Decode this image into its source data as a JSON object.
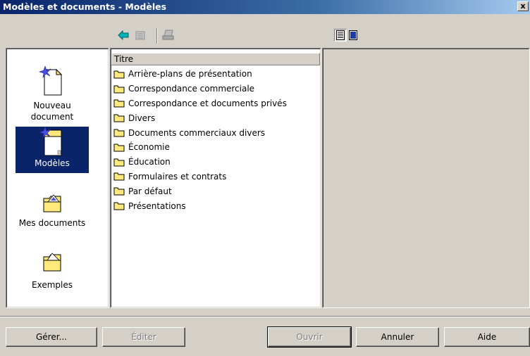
{
  "window": {
    "title": "Modèles et documents - Modèles",
    "close_label": "x"
  },
  "toolbar": {
    "back_icon": "arrow-left-icon",
    "up_icon": "folder-up-icon",
    "print_icon": "printer-icon",
    "view_icons": [
      "document-properties-icon",
      "document-preview-icon"
    ]
  },
  "categories": [
    {
      "label": "Nouveau document",
      "icon": "new-document-icon"
    },
    {
      "label": "Modèles",
      "icon": "templates-icon",
      "selected": true
    },
    {
      "label": "Mes documents",
      "icon": "my-documents-folder-icon"
    },
    {
      "label": "Exemples",
      "icon": "examples-folder-icon"
    }
  ],
  "list": {
    "header": "Titre",
    "items": [
      "Arrière-plans de présentation",
      "Correspondance commerciale",
      "Correspondance et documents privés",
      "Divers",
      "Documents commerciaux divers",
      "Économie",
      "Éducation",
      "Formulaires et contrats",
      "Par défaut",
      "Présentations"
    ]
  },
  "buttons": {
    "manage": "Gérer...",
    "edit": "Éditer",
    "open": "Ouvrir",
    "cancel": "Annuler",
    "help": "Aide"
  },
  "colors": {
    "selection": "#0a246a",
    "folder": "#ffe97a",
    "dialog": "#d4d0c8"
  }
}
